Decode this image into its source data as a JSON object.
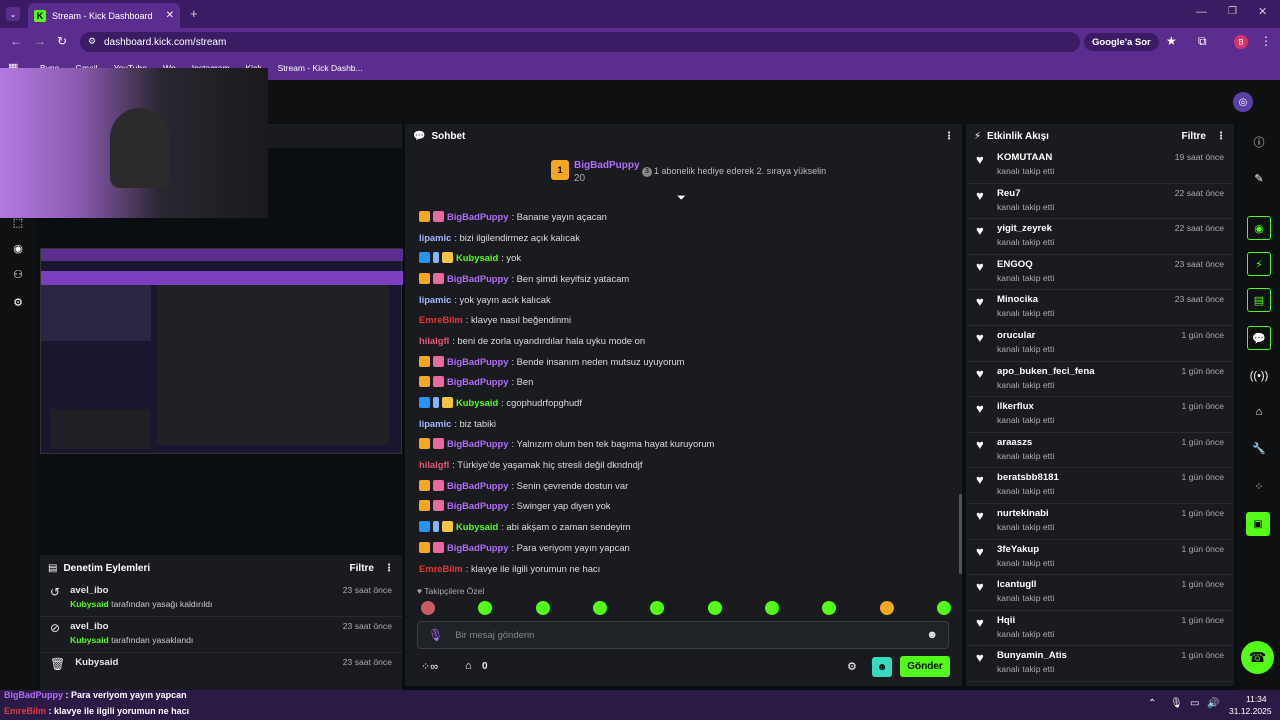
{
  "browser": {
    "tab_title": "Stream - Kick Dashboard",
    "url": "dashboard.kick.com/stream",
    "search_btn": "Google'a Sor",
    "profile": "B",
    "bookmarks": [
      "Bvno",
      "Gmail",
      "YouTube",
      "Wp",
      "Instagram",
      "Kick",
      "Stream - Kick Dashb..."
    ]
  },
  "moderation": {
    "title": "Denetim Eylemleri",
    "filter": "Filtre",
    "items": [
      {
        "user": "avel_ibo",
        "actor": "Kubysaid",
        "action": " tarafından yasağı kaldırıldı",
        "time": "23 saat önce",
        "icon": "undo-icon"
      },
      {
        "user": "avel_ibo",
        "actor": "Kubysaid",
        "action": " tarafından yasaklandı",
        "time": "23 saat önce",
        "icon": "ban-icon"
      },
      {
        "user": "Kubysaid",
        "actor": "",
        "action": "",
        "time": "23 saat önce",
        "icon": "trash-icon"
      }
    ]
  },
  "chat": {
    "title": "Sohbet",
    "pinned_user": "BigBadPuppy",
    "pinned_count": "20",
    "pinned_badge": "3",
    "pinned_note": "1 abonelik hediye ederek 2. sıraya yükselin",
    "messages": [
      {
        "user": "BigBadPuppy",
        "cls": "u-purp",
        "badges": [
          "crown",
          "gift"
        ],
        "text": ": Banane yayın açacan"
      },
      {
        "user": "lipamic",
        "cls": "u-blue",
        "badges": [],
        "text": ": bizi ilgilendirmez açık kalıcak"
      },
      {
        "user": "Kubysaid",
        "cls": "u-green",
        "badges": [
          "mod",
          "ver",
          "subb"
        ],
        "text": ": yok"
      },
      {
        "user": "BigBadPuppy",
        "cls": "u-purp",
        "badges": [
          "crown",
          "gift"
        ],
        "text": ": Ben şimdi keyifsiz yatacam"
      },
      {
        "user": "lipamic",
        "cls": "u-blue",
        "badges": [],
        "text": ": yok yayın acık kalıcak"
      },
      {
        "user": "EmreBilm",
        "cls": "u-red",
        "badges": [],
        "text": ": klavye nasıl beğendinmi"
      },
      {
        "user": "hilalgfl",
        "cls": "u-rose",
        "badges": [],
        "text": ": beni de zorla uyandırdılar hala uyku mode on"
      },
      {
        "user": "BigBadPuppy",
        "cls": "u-purp",
        "badges": [
          "crown",
          "gift"
        ],
        "text": ": Bende insanım neden mutsuz uyuyorum"
      },
      {
        "user": "BigBadPuppy",
        "cls": "u-purp",
        "badges": [
          "crown",
          "gift"
        ],
        "text": ": Ben"
      },
      {
        "user": "Kubysaid",
        "cls": "u-green",
        "badges": [
          "mod",
          "ver",
          "subb"
        ],
        "text": ": cgophudrfopghudf"
      },
      {
        "user": "lipamic",
        "cls": "u-blue",
        "badges": [],
        "text": ": biz tabiki"
      },
      {
        "user": "BigBadPuppy",
        "cls": "u-purp",
        "badges": [
          "crown",
          "gift"
        ],
        "text": ": Yalnızım olum ben tek başıma hayat kuruyorum"
      },
      {
        "user": "hilalgfl",
        "cls": "u-rose",
        "badges": [],
        "text": ": Türkiye'de yaşamak hiç stresli değil dkndndjf"
      },
      {
        "user": "BigBadPuppy",
        "cls": "u-purp",
        "badges": [
          "crown",
          "gift"
        ],
        "text": ": Senin çevrende dostun var"
      },
      {
        "user": "BigBadPuppy",
        "cls": "u-purp",
        "badges": [
          "crown",
          "gift"
        ],
        "text": ": Swinger yap diyen yok"
      },
      {
        "user": "Kubysaid",
        "cls": "u-green",
        "badges": [
          "mod",
          "ver",
          "subb"
        ],
        "text": ": abi akşam o zaman sendeyim"
      },
      {
        "user": "BigBadPuppy",
        "cls": "u-purp",
        "badges": [
          "crown",
          "gift"
        ],
        "text": ": Para veriyom yayın yapcan"
      },
      {
        "user": "EmreBilm",
        "cls": "u-red",
        "badges": [],
        "text": ": klavye ile ilgili yorumun ne hacı"
      }
    ],
    "emote_tab": "Takipçilere Özel",
    "input_placeholder": "Bir mesaj gönderin",
    "points": "0",
    "send": "Gönder"
  },
  "activity": {
    "title": "Etkinlik Akışı",
    "filter": "Filtre",
    "subtitle": "kanalı takip etti",
    "items": [
      {
        "user": "KOMUTAAN",
        "time": "19 saat önce"
      },
      {
        "user": "Reu7",
        "time": "22 saat önce"
      },
      {
        "user": "yigit_zeyrek",
        "time": "22 saat önce"
      },
      {
        "user": "ENGOQ",
        "time": "23 saat önce"
      },
      {
        "user": "Minocika",
        "time": "23 saat önce"
      },
      {
        "user": "orucular",
        "time": "1 gün önce"
      },
      {
        "user": "apo_buken_feci_fena",
        "time": "1 gün önce"
      },
      {
        "user": "ilkerflux",
        "time": "1 gün önce"
      },
      {
        "user": "araaszs",
        "time": "1 gün önce"
      },
      {
        "user": "beratsbb8181",
        "time": "1 gün önce"
      },
      {
        "user": "nurtekinabi",
        "time": "1 gün önce"
      },
      {
        "user": "3feYakup",
        "time": "1 gün önce"
      },
      {
        "user": "lcantugll",
        "time": "1 gün önce"
      },
      {
        "user": "Hqii",
        "time": "1 gün önce"
      },
      {
        "user": "Bunyamin_Atis",
        "time": "1 gün önce"
      }
    ]
  },
  "overlay": {
    "line1_user": "BigBadPuppy",
    "line1_text": " : Para veriyom yayın yapcan",
    "line2_user": "EmreBilm",
    "line2_text": " : klavye ile ilgili yorumun ne hacı"
  },
  "taskbar": {
    "time": "11:34",
    "date": "31.12.2025"
  }
}
